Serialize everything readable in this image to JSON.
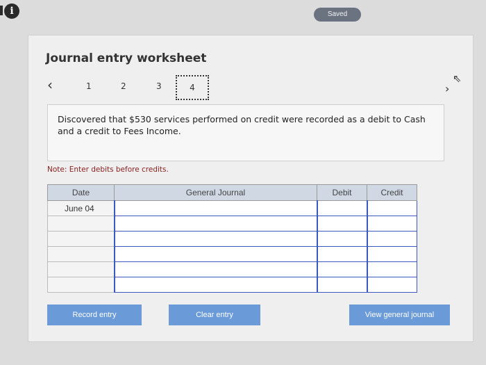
{
  "status": {
    "saved_label": "Saved"
  },
  "worksheet": {
    "title": "Journal entry worksheet",
    "steps": [
      "1",
      "2",
      "3",
      "4"
    ],
    "active_step": "4",
    "description": "Discovered that $530 services performed on credit were recorded as a debit to Cash and a credit to Fees Income.",
    "note": "Note: Enter debits before credits."
  },
  "journal": {
    "headers": {
      "date": "Date",
      "general_journal": "General Journal",
      "debit": "Debit",
      "credit": "Credit"
    },
    "rows": [
      {
        "date": "June 04"
      },
      {
        "date": ""
      },
      {
        "date": ""
      },
      {
        "date": ""
      },
      {
        "date": ""
      },
      {
        "date": ""
      }
    ]
  },
  "buttons": {
    "record": "Record entry",
    "clear": "Clear entry",
    "view": "View general journal"
  },
  "colors": {
    "button_blue": "#6a9ad8",
    "input_border_blue": "#3a58c0",
    "note_red": "#8a2020",
    "header_bg": "#d0d8e4"
  }
}
